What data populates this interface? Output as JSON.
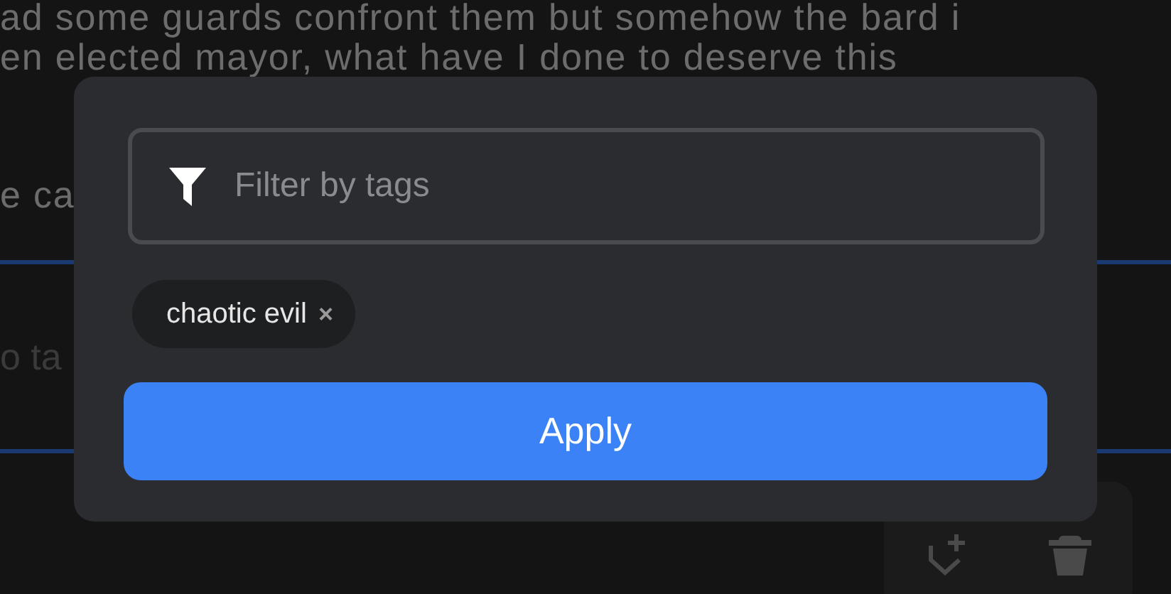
{
  "background": {
    "text_lines": [
      "ad some guards confront them but somehow the bard i",
      "en elected mayor, what have I done to deserve this",
      "e ca"
    ],
    "tag_field": {
      "placeholder": "o ta"
    },
    "actions": [
      {
        "kind": "add-tag"
      },
      {
        "kind": "delete"
      }
    ]
  },
  "filter_dialog": {
    "search": {
      "placeholder": "Filter by tags"
    },
    "tags": [
      {
        "label": "chaotic evil",
        "remove": "×"
      }
    ],
    "apply_button": "Apply"
  }
}
